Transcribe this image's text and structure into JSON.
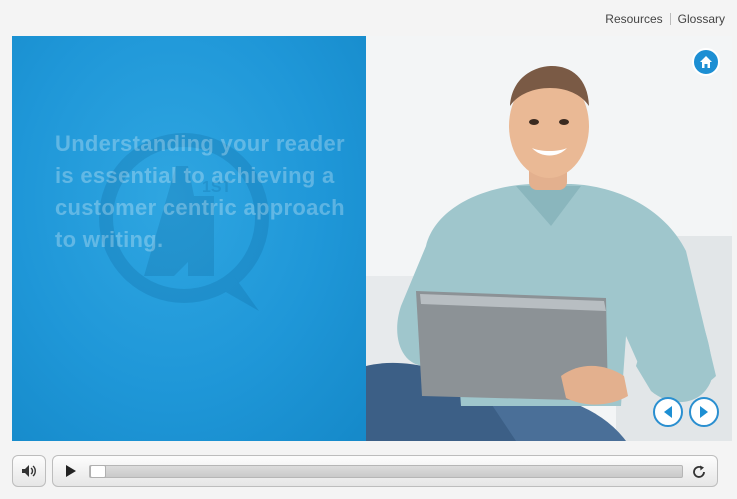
{
  "header": {
    "resources_label": "Resources",
    "glossary_label": "Glossary"
  },
  "slide": {
    "headline": "Understanding your reader is essential to achieving a customer centric approach to writing.",
    "watermark_text": "1ST",
    "image_subject": "smiling man with laptop"
  },
  "colors": {
    "panel_blue": "#1f97d8",
    "accent_blue": "#1d8fd3",
    "page_bg": "#f4f4f4"
  },
  "icons": {
    "home": "home-icon",
    "prev": "arrow-left-icon",
    "next": "arrow-right-icon",
    "volume": "volume-icon",
    "play": "play-icon",
    "replay": "replay-icon"
  },
  "player": {
    "progress": 0.0
  }
}
